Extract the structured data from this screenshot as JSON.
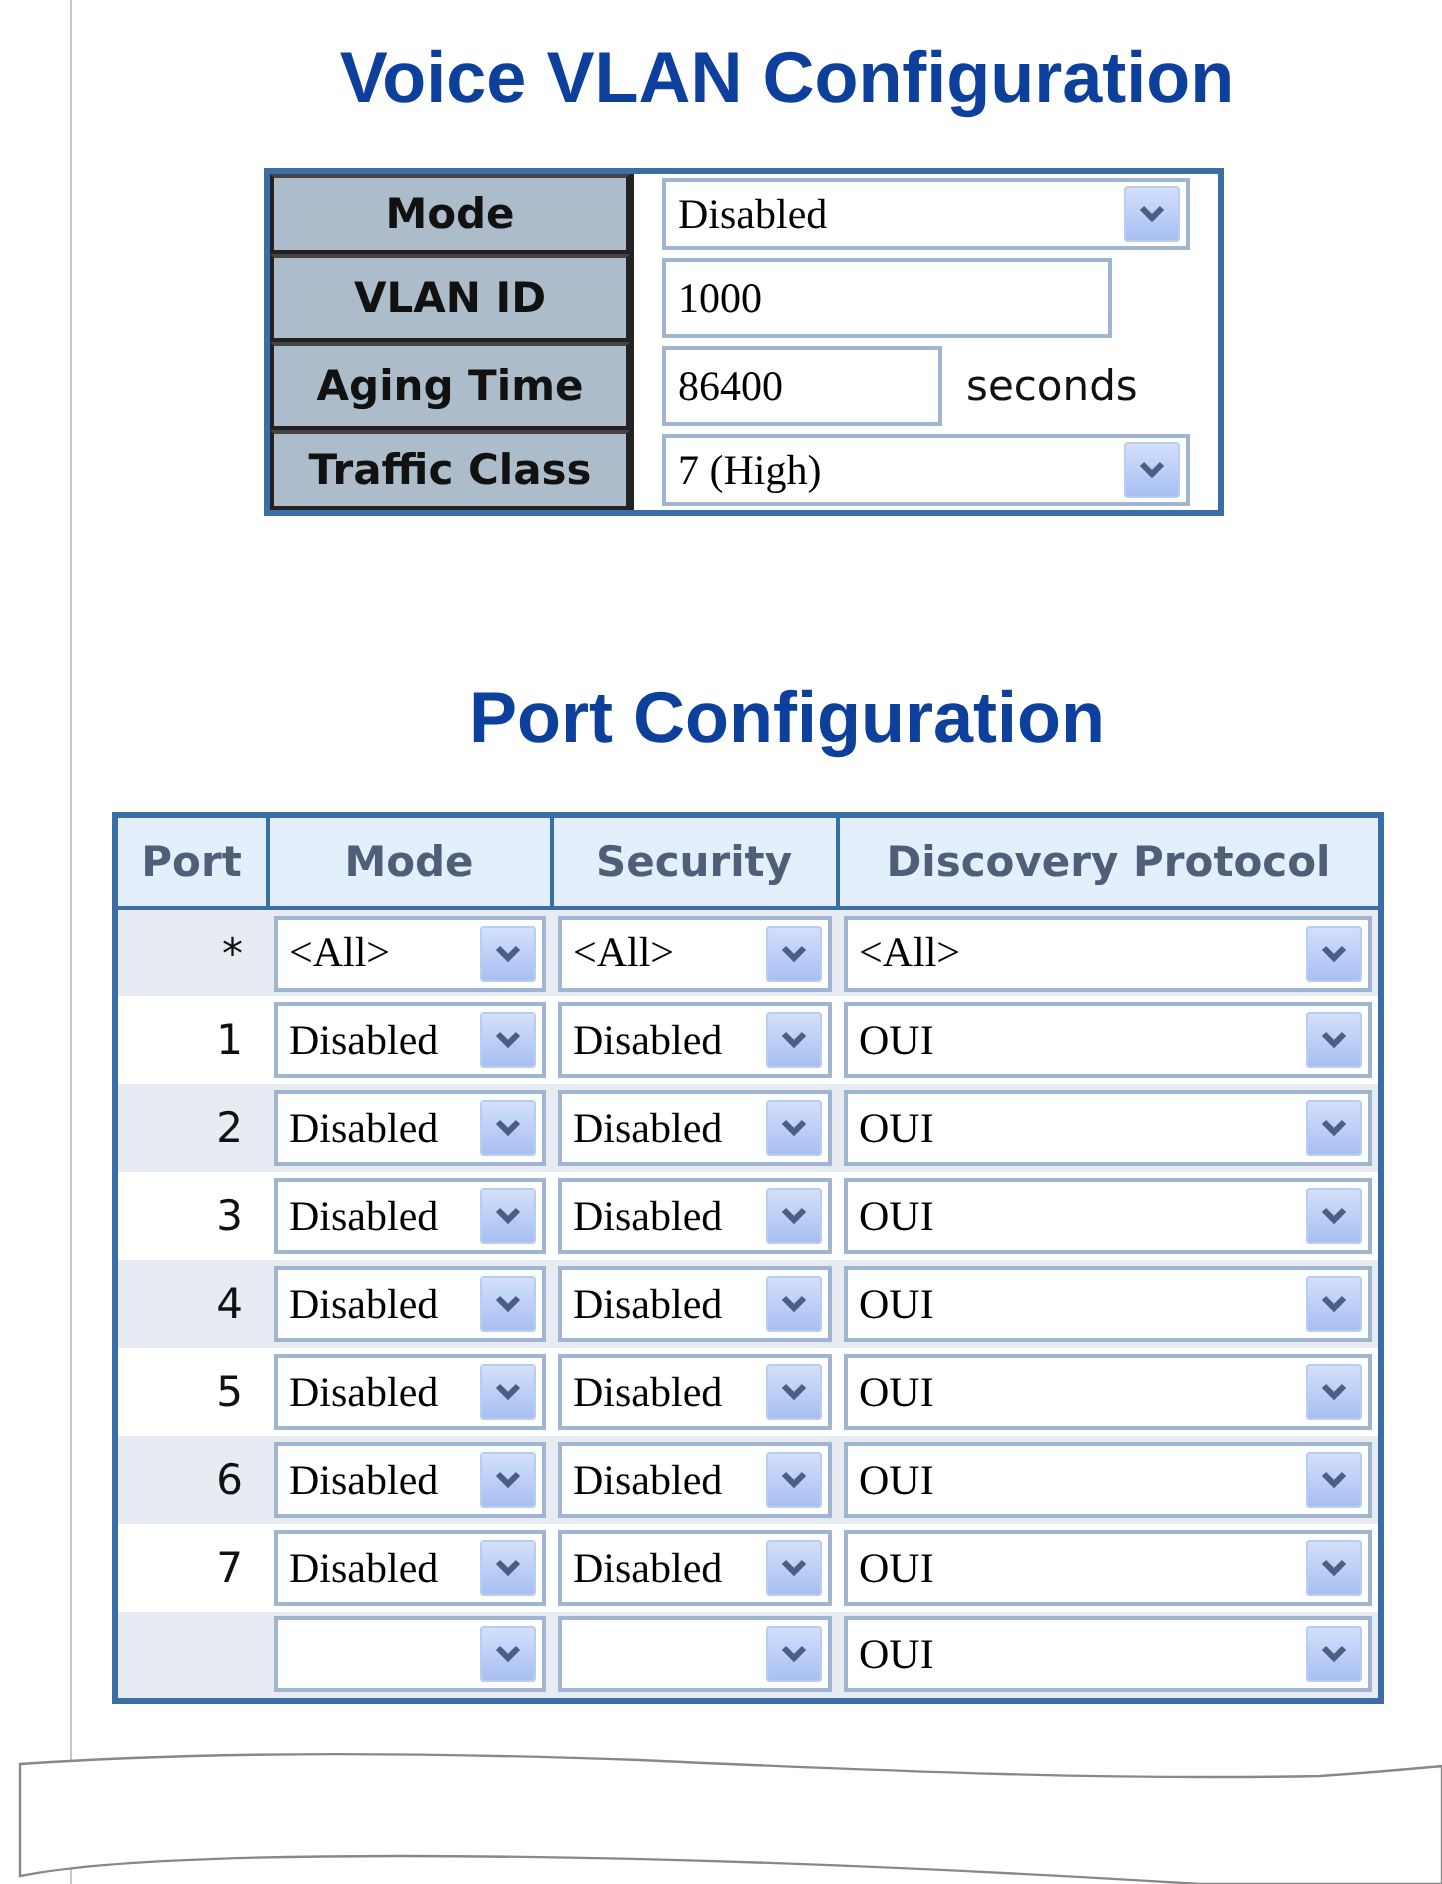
{
  "voice_vlan": {
    "title": "Voice VLAN Configuration",
    "fields": [
      {
        "kind": "select",
        "label": "Mode",
        "value": "Disabled"
      },
      {
        "kind": "input",
        "label": "VLAN ID",
        "value": "1000"
      },
      {
        "kind": "input",
        "label": "Aging Time",
        "value": "86400",
        "unit": "seconds"
      },
      {
        "kind": "select",
        "label": "Traffic Class",
        "value": "7 (High)"
      }
    ]
  },
  "port_configuration": {
    "title": "Port Configuration",
    "columns": [
      "Port",
      "Mode",
      "Security",
      "Discovery Protocol"
    ],
    "rows": [
      {
        "port": "*",
        "mode": "<All>",
        "security": "<All>",
        "discovery": "<All>"
      },
      {
        "port": "1",
        "mode": "Disabled",
        "security": "Disabled",
        "discovery": "OUI"
      },
      {
        "port": "2",
        "mode": "Disabled",
        "security": "Disabled",
        "discovery": "OUI"
      },
      {
        "port": "3",
        "mode": "Disabled",
        "security": "Disabled",
        "discovery": "OUI"
      },
      {
        "port": "4",
        "mode": "Disabled",
        "security": "Disabled",
        "discovery": "OUI"
      },
      {
        "port": "5",
        "mode": "Disabled",
        "security": "Disabled",
        "discovery": "OUI"
      },
      {
        "port": "6",
        "mode": "Disabled",
        "security": "Disabled",
        "discovery": "OUI"
      },
      {
        "port": "7",
        "mode": "Disabled",
        "security": "Disabled",
        "discovery": "OUI"
      },
      {
        "discovery": "OUI"
      }
    ]
  }
}
